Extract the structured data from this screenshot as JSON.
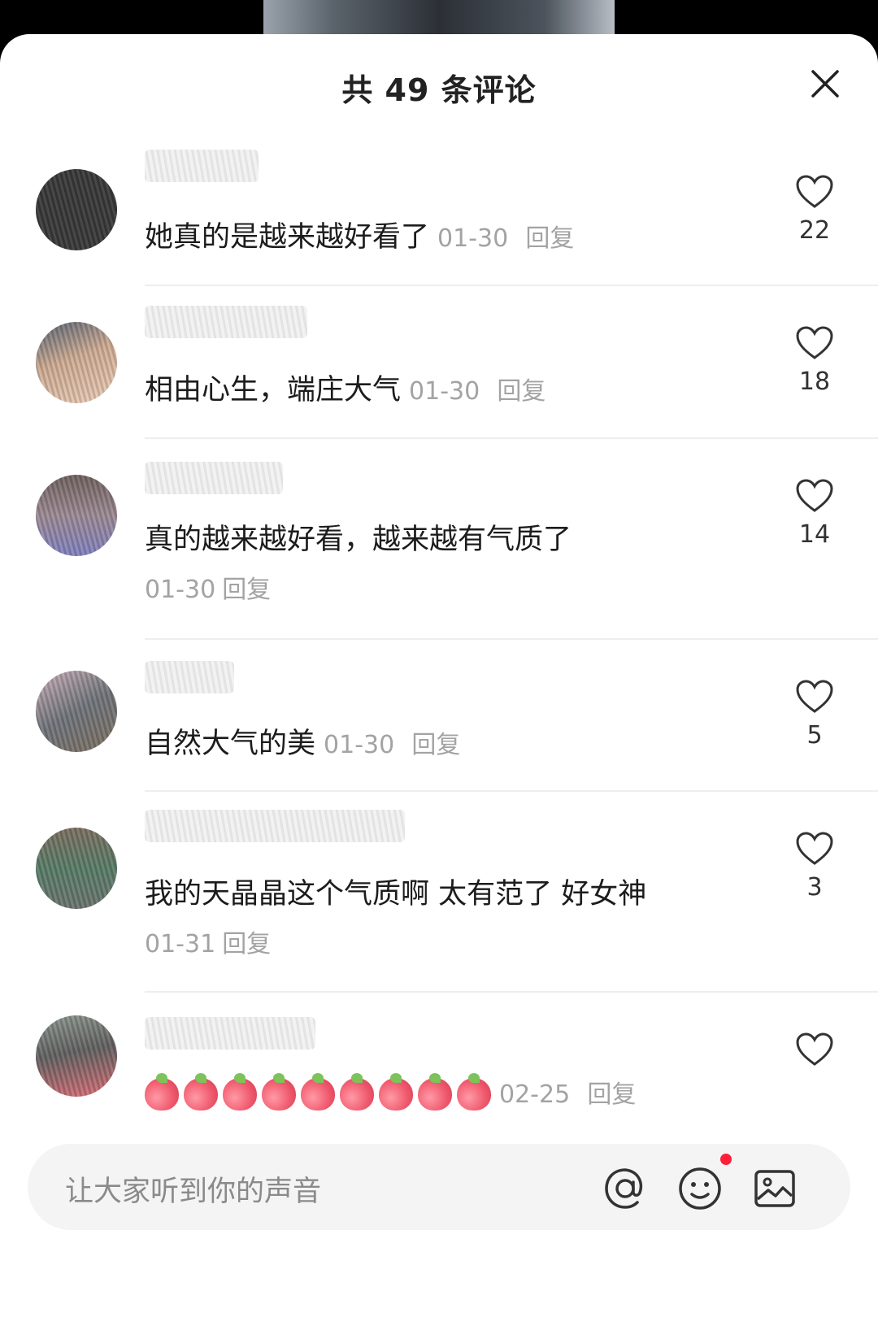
{
  "header": {
    "title": "共 49 条评论",
    "close_icon": "close-icon"
  },
  "comments": [
    {
      "text": "她真的是越来越好看了",
      "date": "01-30",
      "reply": "回复",
      "likes": "22"
    },
    {
      "text": "相由心生，端庄大气",
      "date": "01-30",
      "reply": "回复",
      "likes": "18"
    },
    {
      "text": "真的越来越好看，越来越有气质了",
      "date": "01-30",
      "reply": "回复",
      "likes": "14"
    },
    {
      "text": "自然大气的美",
      "date": "01-30",
      "reply": "回复",
      "likes": "5"
    },
    {
      "text": "我的天晶晶这个气质啊 太有范了 好女神",
      "date": "01-31",
      "reply": "回复",
      "likes": "3"
    },
    {
      "emoji_icon": "peach-emoji-icon",
      "emoji_count": 9,
      "date": "02-25",
      "reply": "回复"
    }
  ],
  "input": {
    "placeholder": "让大家听到你的声音",
    "mention_icon": "at-icon",
    "emoji_icon": "smile-icon",
    "image_icon": "image-icon",
    "notification_dot_color": "#ff1f3a"
  },
  "colors": {
    "text": "#1c1c1c",
    "meta": "#a3a3a3",
    "background": "#ffffff"
  }
}
